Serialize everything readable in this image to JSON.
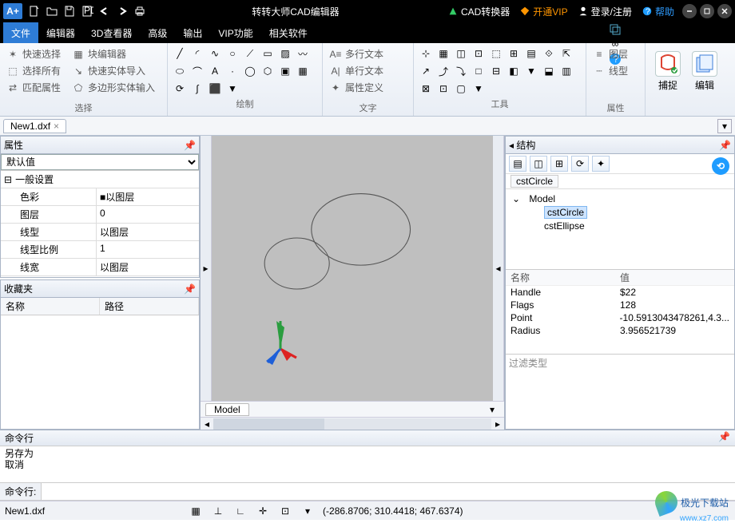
{
  "title": "转转大师CAD编辑器",
  "titlebar_links": {
    "converter": "CAD转换器",
    "vip": "开通VIP",
    "login": "登录/注册",
    "help": "帮助"
  },
  "menus": [
    "文件",
    "编辑器",
    "3D查看器",
    "高级",
    "输出",
    "VIP功能",
    "相关软件"
  ],
  "active_menu": 0,
  "ribbon": {
    "select": {
      "label": "选择",
      "items": [
        "快速选择",
        "块编辑器",
        "选择所有",
        "快速实体导入",
        "匹配属性",
        "多边形实体输入"
      ]
    },
    "draw": {
      "label": "绘制"
    },
    "text": {
      "label": "文字",
      "items": [
        "多行文本",
        "单行文本",
        "属性定义"
      ]
    },
    "tools": {
      "label": "工具"
    },
    "props": {
      "label": "属性",
      "items": [
        "图层",
        "线型"
      ]
    },
    "snap": "捕捉",
    "edit": "编辑"
  },
  "file_tab": "New1.dxf",
  "panels": {
    "props_title": "属性",
    "props_default": "默认值",
    "props_section": "一般设置",
    "props_rows": [
      {
        "k": "色彩",
        "v": "■以图层"
      },
      {
        "k": "图层",
        "v": "0"
      },
      {
        "k": "线型",
        "v": "以图层"
      },
      {
        "k": "线型比例",
        "v": "1"
      },
      {
        "k": "线宽",
        "v": "以图层"
      }
    ],
    "fav_title": "收藏夹",
    "fav_cols": [
      "名称",
      "路径"
    ],
    "struct_title": "结构",
    "crumb": "cstCircle",
    "tree_root": "Model",
    "tree_items": [
      "cstCircle",
      "cstEllipse"
    ],
    "info_hdr": [
      "名称",
      "值"
    ],
    "info_rows": [
      {
        "k": "Handle",
        "v": "$22"
      },
      {
        "k": "Flags",
        "v": "128"
      },
      {
        "k": "Point",
        "v": "-10.5913043478261,4.3..."
      },
      {
        "k": "Radius",
        "v": "3.956521739"
      }
    ],
    "filter": "过滤类型"
  },
  "model_tab": "Model",
  "cmd": {
    "title": "命令行",
    "lines": [
      "另存为",
      "取消"
    ],
    "prompt": "命令行:"
  },
  "status": {
    "file": "New1.dxf",
    "coords": "(-286.8706; 310.4418; 467.6374)"
  },
  "watermark": {
    "main": "极光下载站",
    "sub": "www.xz7.com"
  }
}
